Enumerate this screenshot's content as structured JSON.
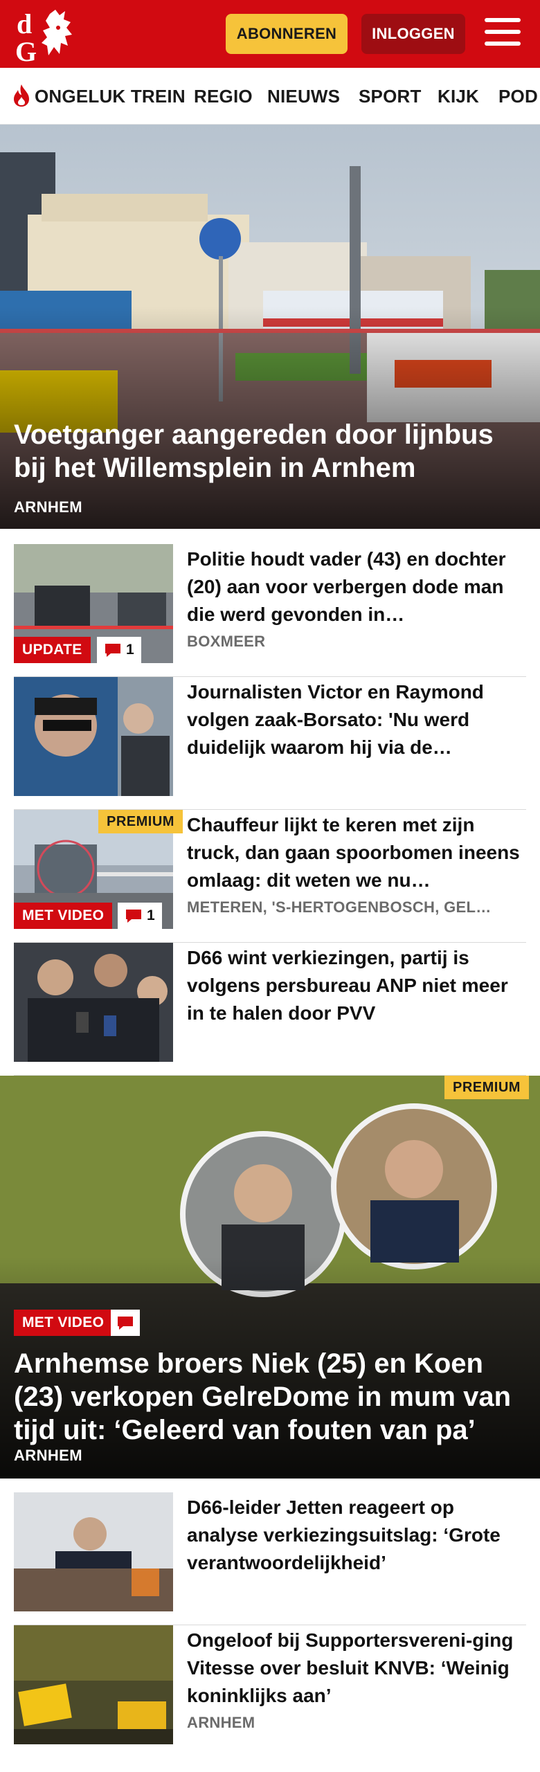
{
  "header": {
    "subscribe_label": "ABONNEREN",
    "login_label": "INLOGGEN",
    "brand_color": "#d10a11",
    "subscribe_color": "#f6c33a"
  },
  "nav": {
    "items": [
      {
        "label": "ONGELUK TREIN",
        "icon": "flame-icon"
      },
      {
        "label": "REGIO"
      },
      {
        "label": "NIEUWS"
      },
      {
        "label": "SPORT"
      },
      {
        "label": "KIJK"
      },
      {
        "label": "POD"
      }
    ]
  },
  "hero": {
    "title": "Voetganger aangereden door lijnbus bij het Willemsplein in Arnhem",
    "location": "ARNHEM"
  },
  "articles": [
    {
      "title": "Politie houdt vader (43) en dochter (20) aan voor verbergen dode man die werd gevonden in…",
      "location": "BOXMEER",
      "badge": "UPDATE",
      "comments": "1"
    },
    {
      "title": "Journalisten Victor en Raymond volgen zaak-Borsato: 'Nu werd duidelijk waarom hij via de…",
      "location": ""
    },
    {
      "title": "Chauffeur lijkt te keren met zijn truck, dan gaan spoorbomen ineens omlaag: dit weten we nu…",
      "location": "METEREN, 'S-HERTOGENBOSCH, GEL…",
      "badge": "MET VIDEO",
      "comments": "1",
      "premium": "PREMIUM"
    },
    {
      "title": "D66 wint verkiezingen, partij is volgens persbureau ANP niet meer in te halen door PVV",
      "location": ""
    }
  ],
  "feature": {
    "title": "Arnhemse broers Niek (25) en Koen (23) verkopen GelreDome in mum van tijd uit: ‘Geleerd van fouten van pa’",
    "location": "ARNHEM",
    "badge": "MET VIDEO",
    "premium": "PREMIUM"
  },
  "articles2": [
    {
      "title": "D66-leider Jetten reageert op analyse verkiezingsuitslag: ‘Grote verantwoordelijkheid’",
      "location": ""
    },
    {
      "title": "Ongeloof bij Supportersvereni-ging Vitesse over besluit KNVB: ‘Weinig koninklijks aan’",
      "location": "ARNHEM"
    }
  ]
}
